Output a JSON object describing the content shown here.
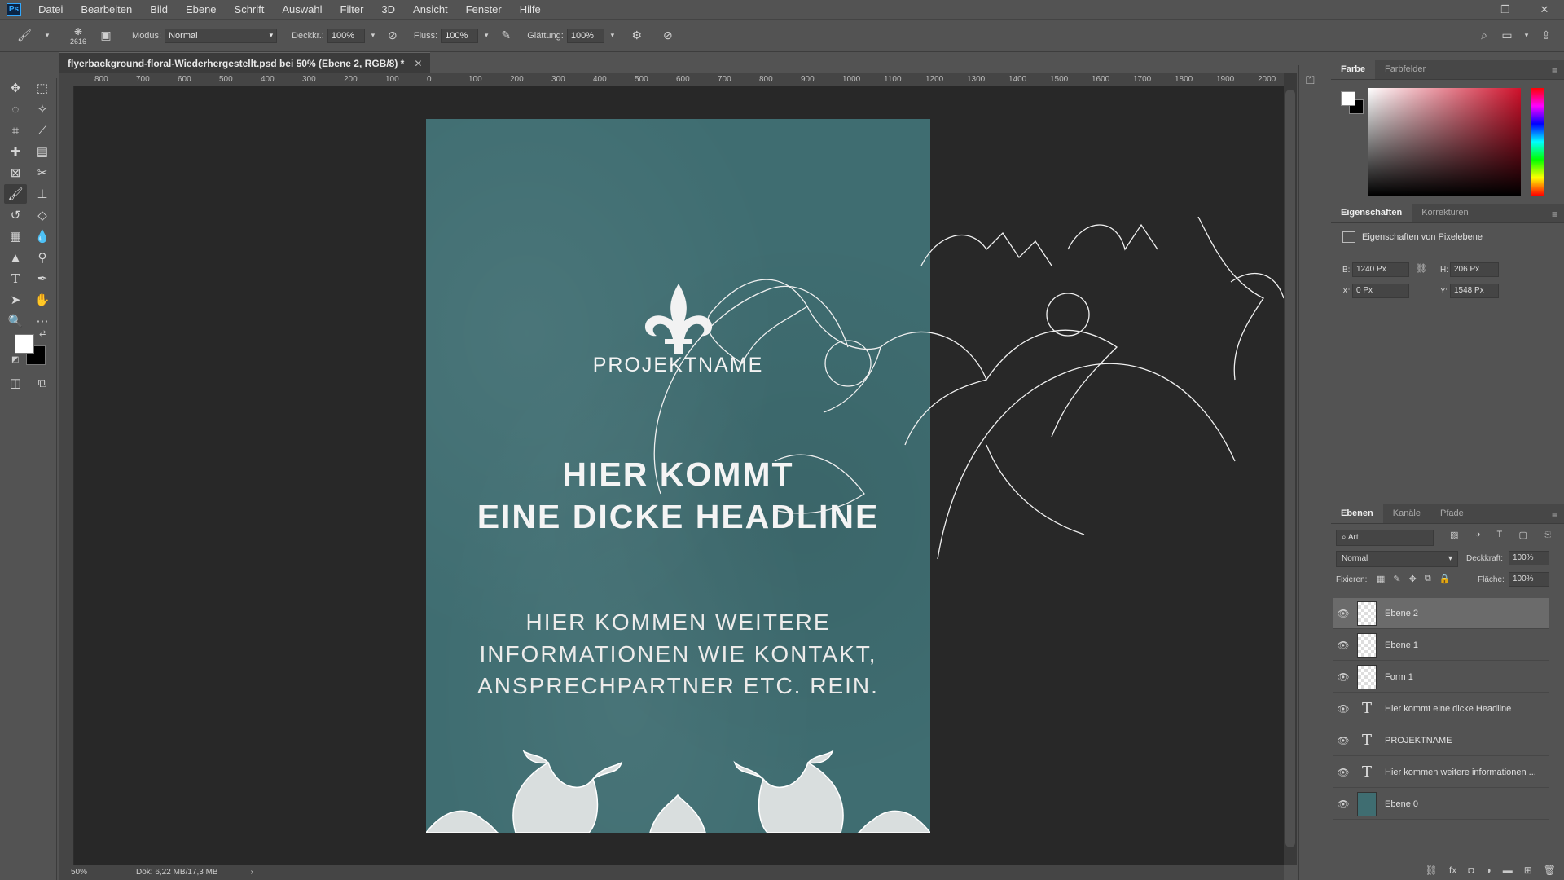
{
  "app": {
    "logo": "Ps"
  },
  "menu": [
    "Datei",
    "Bearbeiten",
    "Bild",
    "Ebene",
    "Schrift",
    "Auswahl",
    "Filter",
    "3D",
    "Ansicht",
    "Fenster",
    "Hilfe"
  ],
  "window_controls": {
    "minimize_icon": "minimize-icon",
    "restore_icon": "restore-icon",
    "close_icon": "close-icon"
  },
  "options": {
    "brush_size": "2616",
    "mode_label": "Modus:",
    "mode_value": "Normal",
    "opacity_label": "Deckkr.:",
    "opacity_value": "100%",
    "flow_label": "Fluss:",
    "flow_value": "100%",
    "smoothing_label": "Glättung:",
    "smoothing_value": "100%"
  },
  "document": {
    "tab_title": "flyerbackground-floral-Wiederhergestellt.psd bei 50% (Ebene 2, RGB/8) *",
    "zoom": "50%",
    "doc_size": "Dok: 6,22 MB/17,3 MB",
    "ruler_ticks": [
      "800",
      "700",
      "600",
      "500",
      "400",
      "300",
      "200",
      "100",
      "0",
      "100",
      "200",
      "300",
      "400",
      "500",
      "600",
      "700",
      "800",
      "900",
      "1000",
      "1100",
      "1200",
      "1300",
      "1400",
      "1500",
      "1600",
      "1700",
      "1800",
      "1900",
      "2000"
    ]
  },
  "flyer": {
    "project_name": "PROJEKTNAME",
    "headline_line1": "HIER KOMMT",
    "headline_line2": "EINE DICKE HEADLINE",
    "info_line1": "HIER KOMMEN WEITERE",
    "info_line2": "INFORMATIONEN WIE KONTAKT,",
    "info_line3": "ANSPRECHPARTNER ETC. REIN.",
    "bg_color": "#3f6d71"
  },
  "color_panel": {
    "tabs": [
      "Farbe",
      "Farbfelder"
    ]
  },
  "properties_panel": {
    "tabs": [
      "Eigenschaften",
      "Korrekturen"
    ],
    "title": "Eigenschaften von Pixelebene",
    "w_label": "B:",
    "w_value": "1240 Px",
    "h_label": "H:",
    "h_value": "206 Px",
    "x_label": "X:",
    "x_value": "0 Px",
    "y_label": "Y:",
    "y_value": "1548 Px"
  },
  "layers_panel": {
    "tabs": [
      "Ebenen",
      "Kanäle",
      "Pfade"
    ],
    "search_placeholder": "Art",
    "blend_mode": "Normal",
    "opacity_label": "Deckkraft:",
    "opacity_value": "100%",
    "lock_label": "Fixieren:",
    "fill_label": "Fläche:",
    "fill_value": "100%",
    "layers": [
      {
        "name": "Ebene 2",
        "kind": "pixel",
        "selected": true
      },
      {
        "name": "Ebene 1",
        "kind": "pixel",
        "selected": false
      },
      {
        "name": "Form 1",
        "kind": "shape",
        "selected": false
      },
      {
        "name": "Hier kommt  eine dicke Headline",
        "kind": "text",
        "selected": false
      },
      {
        "name": "PROJEKTNAME",
        "kind": "text",
        "selected": false
      },
      {
        "name": "Hier kommen weitere informationen ...",
        "kind": "text",
        "selected": false
      },
      {
        "name": "Ebene 0",
        "kind": "fill",
        "selected": false
      }
    ]
  }
}
